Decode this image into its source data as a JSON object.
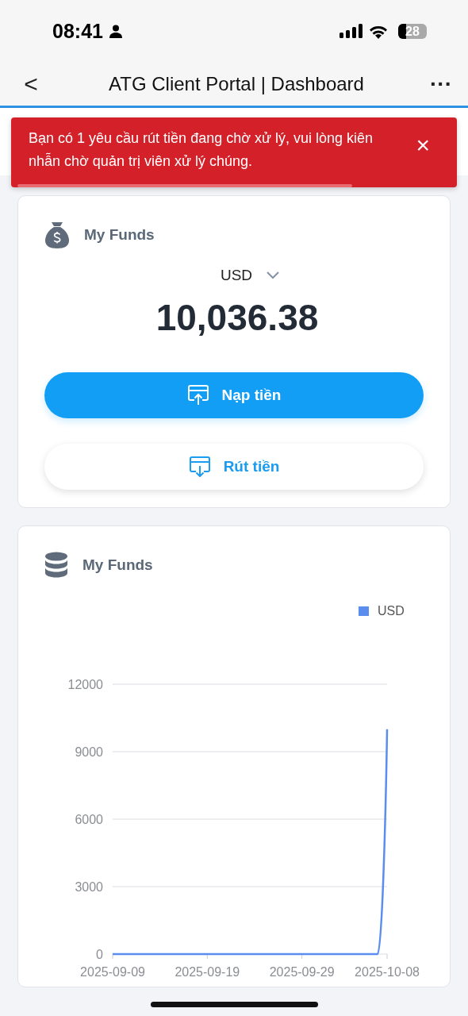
{
  "status_bar": {
    "time": "08:41",
    "battery": "28"
  },
  "nav": {
    "back": "<",
    "title": "ATG Client Portal | Dashboard",
    "more": "···"
  },
  "alert": {
    "message": "Bạn có 1 yêu cầu rút tiền đang chờ xử lý, vui lòng kiên nhẫn chờ quản trị viên xử lý chúng.",
    "close": "×"
  },
  "funds_card": {
    "title": "My Funds",
    "currency": "USD",
    "amount": "10,036.38",
    "buttons": [
      {
        "kind": "primary",
        "label": "Nạp tiền"
      },
      {
        "kind": "secondary",
        "label": "Rút tiền"
      }
    ]
  },
  "chart_card": {
    "title": "My Funds",
    "chart_data": {
      "type": "line",
      "categories": [
        "2025-09-09",
        null,
        null,
        null,
        null,
        null,
        null,
        null,
        null,
        null,
        "2025-09-19",
        null,
        null,
        null,
        null,
        null,
        null,
        null,
        null,
        null,
        "2025-09-29",
        null,
        null,
        null,
        null,
        null,
        null,
        null,
        null,
        "2025-10-08"
      ],
      "series": [
        {
          "name": "USD",
          "color": "#5b8def",
          "values": [
            0,
            0,
            0,
            0,
            0,
            0,
            0,
            0,
            0,
            0,
            0,
            0,
            0,
            0,
            0,
            0,
            0,
            0,
            0,
            0,
            0,
            0,
            0,
            0,
            0,
            0,
            0,
            0,
            0,
            10000
          ]
        }
      ],
      "ylim": [
        0,
        12000
      ],
      "grid": true,
      "yticks": [
        {
          "value": 0,
          "label": "0"
        },
        {
          "value": 3000,
          "label": "3000"
        },
        {
          "value": 6000,
          "label": "6000"
        },
        {
          "value": 9000,
          "label": "9000"
        },
        {
          "value": 12000,
          "label": "12000"
        }
      ]
    }
  }
}
